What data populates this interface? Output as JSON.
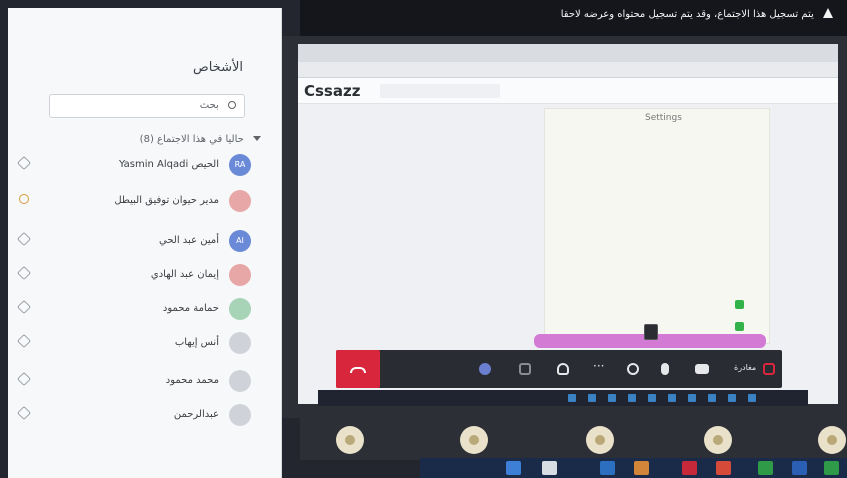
{
  "notice": {
    "text": "يتم تسجيل هذا الاجتماع، وقد يتم تسجيل محتواه وعرضه لاحقا",
    "icon": "warning-icon"
  },
  "panel": {
    "title": "الأشخاص",
    "search_placeholder": "بحث",
    "section_title": "حاليا في هذا الاجتماع (8)",
    "people": [
      {
        "initials": "RA",
        "name": "الحيص Yasmin Alqadi",
        "color": "#6a8ad8"
      },
      {
        "initials": "",
        "name": "مدير حيوان توفيق البيطل",
        "color": "#e7a7a7"
      },
      {
        "initials": "AI",
        "name": "أمين عبد الحي",
        "color": "#6a8ad8"
      },
      {
        "initials": "",
        "name": "إيمان عبد الهادي",
        "color": "#e7a7a7"
      },
      {
        "initials": "",
        "name": "حمامة محمود",
        "color": "#a7d3b7"
      },
      {
        "initials": "",
        "name": "أنس إيهاب",
        "color": "#cfd3d9"
      },
      {
        "initials": "",
        "name": "محمد محمود",
        "color": "#cfd3d9"
      },
      {
        "initials": "",
        "name": "عبدالرحمن",
        "color": "#cfd3d9"
      }
    ]
  },
  "browser": {
    "url": "",
    "app_name": "Cssazz",
    "search_placeholder": "",
    "nav_links": [
      "",
      "",
      "",
      ""
    ],
    "settings_title": "Settings",
    "fields": [
      {
        "label": "",
        "value": ""
      },
      {
        "label": "",
        "value": ""
      },
      {
        "label": "",
        "value": ""
      },
      {
        "label": "",
        "value": ""
      },
      {
        "label": "",
        "value": ""
      }
    ],
    "toggles": [
      {
        "label": ""
      },
      {
        "label": ""
      }
    ]
  },
  "tooltip": "",
  "controls": {
    "timer": "",
    "leave_label": "مغادرة",
    "accent_color": "#d8273c"
  },
  "taskbar": {
    "remote_label": ""
  }
}
